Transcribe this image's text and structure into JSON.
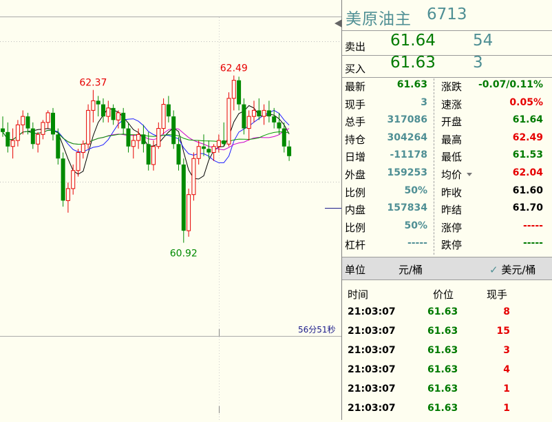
{
  "instrument": {
    "name": "美原油主",
    "code": "6713"
  },
  "ask": {
    "label": "卖出",
    "price": "61.64",
    "volume": "54"
  },
  "bid": {
    "label": "买入",
    "price": "61.63",
    "volume": "3"
  },
  "stats_left": [
    {
      "label": "最新",
      "value": "61.63",
      "color": "#007a00"
    },
    {
      "label": "现手",
      "value": "3",
      "color": "#4f8f94"
    },
    {
      "label": "总手",
      "value": "317086",
      "color": "#4f8f94"
    },
    {
      "label": "持仓",
      "value": "304264",
      "color": "#4f8f94"
    },
    {
      "label": "日增",
      "value": "-11178",
      "color": "#4f8f94"
    },
    {
      "label": "外盘",
      "value": "159253",
      "color": "#4f8f94"
    },
    {
      "label": "比例",
      "value": "50%",
      "color": "#4f8f94"
    },
    {
      "label": "内盘",
      "value": "157834",
      "color": "#4f8f94"
    },
    {
      "label": "比例",
      "value": "50%",
      "color": "#4f8f94"
    },
    {
      "label": "杠杆",
      "value": "-----",
      "color": "#4f8f94"
    }
  ],
  "stats_right": [
    {
      "label": "涨跌",
      "value": "-0.07/0.11%",
      "color": "#007a00"
    },
    {
      "label": "速涨",
      "value": "0.05%",
      "color": "#e60000"
    },
    {
      "label": "开盘",
      "value": "61.64",
      "color": "#007a00"
    },
    {
      "label": "最高",
      "value": "62.49",
      "color": "#e60000"
    },
    {
      "label": "最低",
      "value": "61.53",
      "color": "#007a00"
    },
    {
      "label": "均价",
      "value": "62.04",
      "color": "#e60000"
    },
    {
      "label": "昨收",
      "value": "61.60",
      "color": "#000000"
    },
    {
      "label": "昨结",
      "value": "61.70",
      "color": "#000000"
    },
    {
      "label": "涨停",
      "value": "-----",
      "color": "#e60000"
    },
    {
      "label": "跌停",
      "value": "-----",
      "color": "#007a00"
    }
  ],
  "unit": {
    "label": "单位",
    "value": "元/桶",
    "option": "美元/桶",
    "option_checked": true
  },
  "ticks_header": {
    "time": "时间",
    "price": "价位",
    "volume": "现手"
  },
  "ticks": [
    {
      "time": "21:03:07",
      "price": "61.63",
      "volume": "8"
    },
    {
      "time": "21:03:07",
      "price": "61.63",
      "volume": "15"
    },
    {
      "time": "21:03:07",
      "price": "61.63",
      "volume": "3"
    },
    {
      "time": "21:03:07",
      "price": "61.63",
      "volume": "4"
    },
    {
      "time": "21:03:07",
      "price": "61.63",
      "volume": "1"
    },
    {
      "time": "21:03:07",
      "price": "61.63",
      "volume": "1"
    }
  ],
  "chart": {
    "timer": "56分51秒",
    "high_label": "62.49",
    "local_high_label": "62.37",
    "low_label": "60.92",
    "colors": {
      "up": "#e60000",
      "down": "#008a00"
    },
    "candles": [
      [
        62.05,
        62.15,
        61.98,
        62.02
      ],
      [
        62.02,
        62.1,
        61.85,
        61.9
      ],
      [
        61.9,
        62.05,
        61.8,
        61.95
      ],
      [
        61.95,
        62.12,
        61.9,
        62.08
      ],
      [
        62.08,
        62.2,
        62.0,
        62.15
      ],
      [
        62.15,
        62.18,
        62.0,
        62.05
      ],
      [
        62.05,
        62.1,
        61.88,
        61.92
      ],
      [
        61.92,
        62.02,
        61.85,
        62.0
      ],
      [
        62.0,
        62.12,
        61.96,
        62.1
      ],
      [
        62.1,
        62.2,
        62.05,
        62.18
      ],
      [
        62.18,
        62.22,
        61.95,
        62.0
      ],
      [
        62.0,
        62.05,
        61.75,
        61.8
      ],
      [
        61.8,
        61.85,
        61.4,
        61.45
      ],
      [
        61.45,
        61.6,
        61.35,
        61.55
      ],
      [
        61.55,
        61.75,
        61.5,
        61.7
      ],
      [
        61.7,
        61.88,
        61.65,
        61.85
      ],
      [
        61.85,
        61.95,
        61.8,
        61.92
      ],
      [
        61.92,
        62.25,
        61.88,
        62.2
      ],
      [
        62.2,
        62.37,
        62.1,
        62.28
      ],
      [
        62.28,
        62.32,
        62.15,
        62.25
      ],
      [
        62.25,
        62.3,
        62.1,
        62.15
      ],
      [
        62.15,
        62.28,
        62.1,
        62.22
      ],
      [
        62.22,
        62.25,
        62.08,
        62.12
      ],
      [
        62.12,
        62.2,
        62.05,
        62.18
      ],
      [
        62.18,
        62.22,
        62.0,
        62.05
      ],
      [
        62.05,
        62.1,
        61.85,
        61.9
      ],
      [
        61.9,
        62.0,
        61.8,
        61.95
      ],
      [
        61.95,
        62.05,
        61.88,
        62.0
      ],
      [
        62.0,
        62.08,
        61.85,
        61.92
      ],
      [
        61.92,
        62.02,
        61.7,
        61.75
      ],
      [
        61.75,
        61.95,
        61.7,
        61.9
      ],
      [
        61.9,
        62.1,
        61.88,
        62.05
      ],
      [
        62.05,
        62.3,
        62.0,
        62.25
      ],
      [
        62.25,
        62.32,
        62.1,
        62.15
      ],
      [
        62.15,
        62.2,
        61.88,
        61.92
      ],
      [
        61.92,
        61.98,
        61.7,
        61.75
      ],
      [
        61.75,
        61.8,
        61.1,
        61.2
      ],
      [
        61.2,
        61.55,
        61.15,
        61.5
      ],
      [
        61.5,
        61.85,
        61.45,
        61.8
      ],
      [
        61.8,
        61.95,
        61.75,
        61.9
      ],
      [
        61.9,
        62.0,
        61.82,
        61.88
      ],
      [
        61.88,
        61.95,
        61.8,
        61.85
      ],
      [
        61.85,
        61.92,
        61.78,
        61.9
      ],
      [
        61.9,
        62.0,
        61.85,
        61.95
      ],
      [
        61.95,
        62.1,
        61.9,
        61.92
      ],
      [
        61.92,
        62.35,
        61.9,
        62.3
      ],
      [
        62.3,
        62.49,
        62.2,
        62.45
      ],
      [
        62.45,
        62.48,
        62.2,
        62.25
      ],
      [
        62.25,
        62.3,
        62.0,
        62.05
      ],
      [
        62.05,
        62.2,
        61.95,
        62.15
      ],
      [
        62.15,
        62.28,
        62.1,
        62.2
      ],
      [
        62.2,
        62.3,
        62.12,
        62.15
      ],
      [
        62.15,
        62.25,
        62.08,
        62.2
      ],
      [
        62.2,
        62.28,
        62.1,
        62.15
      ],
      [
        62.15,
        62.22,
        62.05,
        62.1
      ],
      [
        62.1,
        62.18,
        62.0,
        62.05
      ],
      [
        62.05,
        62.1,
        61.85,
        61.9
      ],
      [
        61.9,
        61.95,
        61.78,
        61.82
      ]
    ],
    "price_min": 60.6,
    "price_max": 62.9
  }
}
